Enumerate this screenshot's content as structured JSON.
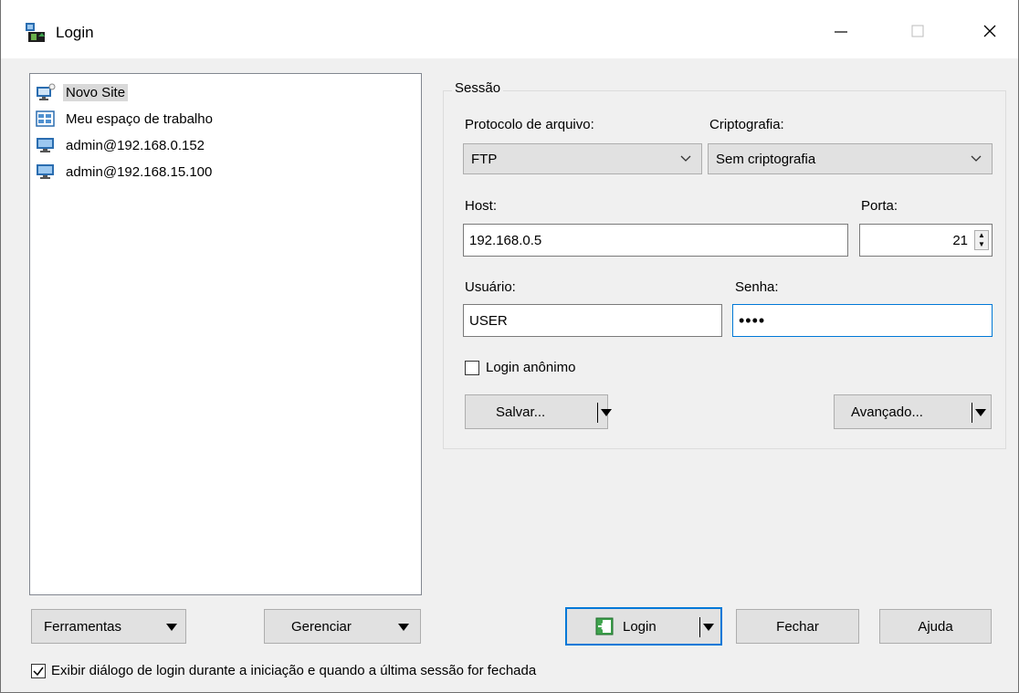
{
  "window": {
    "title": "Login"
  },
  "sites": [
    {
      "label": "Novo Site",
      "icon": "new-site-icon",
      "selected": true
    },
    {
      "label": "Meu espaço de trabalho",
      "icon": "workspace-icon",
      "selected": false
    },
    {
      "label": "admin@192.168.0.152",
      "icon": "computer-icon",
      "selected": false
    },
    {
      "label": "admin@192.168.15.100",
      "icon": "computer-icon",
      "selected": false
    }
  ],
  "session": {
    "group_title": "Sessão",
    "protocol_label": "Protocolo de arquivo:",
    "protocol_value": "FTP",
    "encryption_label": "Criptografia:",
    "encryption_value": "Sem criptografia",
    "host_label": "Host:",
    "host_value": "192.168.0.5",
    "port_label": "Porta:",
    "port_value": "21",
    "user_label": "Usuário:",
    "user_value": "USER",
    "password_label": "Senha:",
    "password_value": "••••",
    "anonymous_label": "Login anônimo",
    "anonymous_checked": false,
    "save_label": "Salvar...",
    "advanced_label": "Avançado..."
  },
  "bottom": {
    "tools_label": "Ferramentas",
    "manage_label": "Gerenciar",
    "login_label": "Login",
    "close_label": "Fechar",
    "help_label": "Ajuda",
    "show_dialog_label": "Exibir diálogo de login durante a iniciação e quando a última sessão for fechada",
    "show_dialog_checked": true
  },
  "colors": {
    "accent": "#0078d7",
    "button_bg": "#e1e1e1",
    "window_bg": "#f0f0f0"
  }
}
